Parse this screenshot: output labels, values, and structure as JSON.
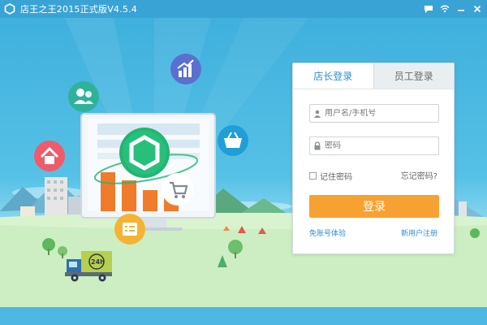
{
  "window": {
    "title": "店王之王2015正式版V4.5.4",
    "controls": [
      "chat-icon",
      "wifi-icon",
      "minimize-icon",
      "close-icon"
    ]
  },
  "login": {
    "tabs": [
      {
        "label": "店长登录",
        "active": true
      },
      {
        "label": "员工登录",
        "active": false
      }
    ],
    "username_placeholder": "用户名/手机号",
    "password_placeholder": "密码",
    "remember_label": "记住密码",
    "forgot_label": "忘记密码?",
    "login_button": "登录",
    "free_trial_link": "免账号体验",
    "register_link": "新用户注册"
  },
  "illustration": {
    "truck_badge": "24h",
    "icons": [
      "users-icon",
      "chart-icon",
      "home-icon",
      "basket-icon",
      "cart-icon",
      "form-icon",
      "brand-hexagon-icon"
    ]
  },
  "colors": {
    "titlebar": "#3aa3d6",
    "accent_blue": "#2d8ed9",
    "login_orange": "#f7a132",
    "brand_green": "#22b573"
  }
}
